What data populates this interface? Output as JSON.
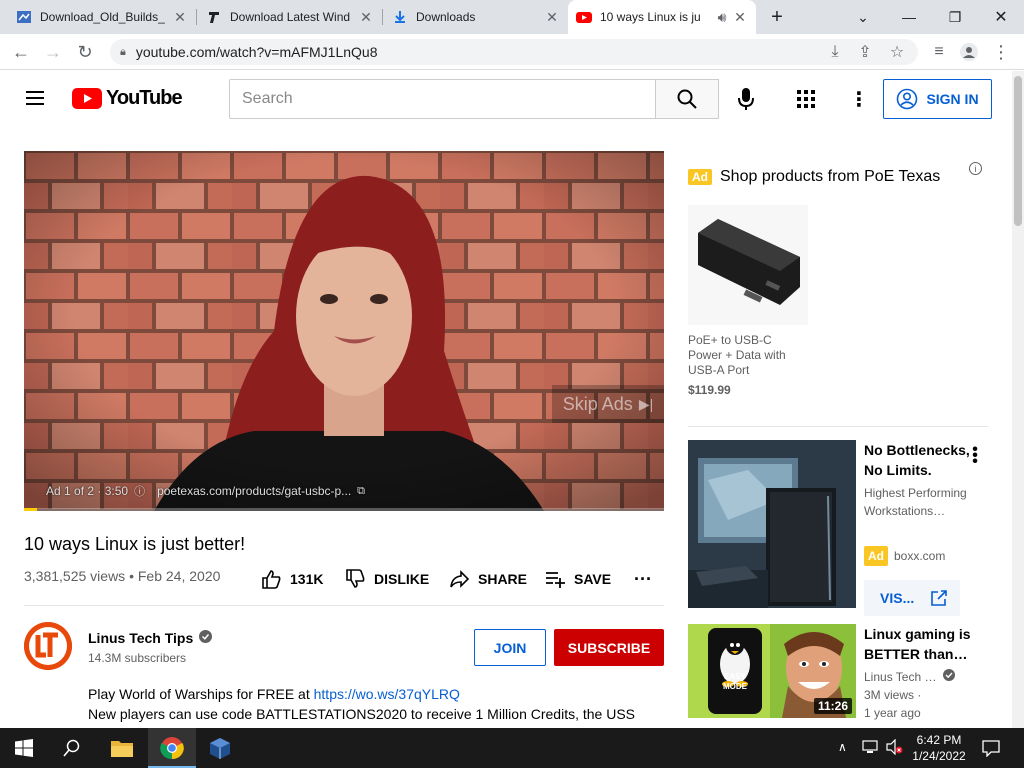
{
  "browser": {
    "tabs": [
      {
        "title": "Download_Old_Builds_"
      },
      {
        "title": "Download Latest Wind"
      },
      {
        "title": "Downloads"
      },
      {
        "title": "10 ways Linux is ju"
      }
    ],
    "new_tab_label": "+",
    "url": "youtube.com/watch?v=mAFMJ1LnQu8"
  },
  "youtube": {
    "logo_text": "YouTube",
    "search_placeholder": "Search",
    "signin_label": "SIGN IN"
  },
  "video": {
    "ad_counter": "Ad 1 of 2 · 3:50",
    "ad_url": "poetexas.com/products/gat-usbc-p...",
    "skip_label": "Skip Ads",
    "ad_progress": 0.02,
    "title": "10 ways Linux is just better!",
    "views": "3,381,525 views",
    "date": "Feb 24, 2020",
    "likes": "131K",
    "dislike_label": "DISLIKE",
    "share_label": "SHARE",
    "save_label": "SAVE"
  },
  "channel": {
    "name": "Linus Tech Tips",
    "subscribers": "14.3M subscribers",
    "join_label": "JOIN",
    "subscribe_label": "SUBSCRIBE",
    "avatar_text": "LTT"
  },
  "description": {
    "line1_text": "Play World of Warships for FREE at ",
    "line1_link": "https://wo.ws/37qYLRQ",
    "line2": "New players can use code BATTLESTATIONS2020 to receive 1 Million Credits, the USS"
  },
  "sidebar": {
    "ad_badge": "Ad",
    "shop_title": "Shop products from PoE Texas",
    "product_name": "PoE+ to USB-C Power + Data with USB-A Port",
    "product_price": "$119.99",
    "promo": {
      "title": "No Bottlenecks, No Limits.",
      "description": "Highest Performing Workstations…",
      "advertiser": "boxx.com",
      "visit_label": "VIS..."
    },
    "rec": {
      "title": "Linux gaming is BETTER than…",
      "channel": "Linus Tech …",
      "views": "3M views ·",
      "age": "1 year ago",
      "duration": "11:26",
      "thumb_text": "EASY MODE"
    }
  },
  "taskbar": {
    "time": "6:42 PM",
    "date": "1/24/2022"
  }
}
